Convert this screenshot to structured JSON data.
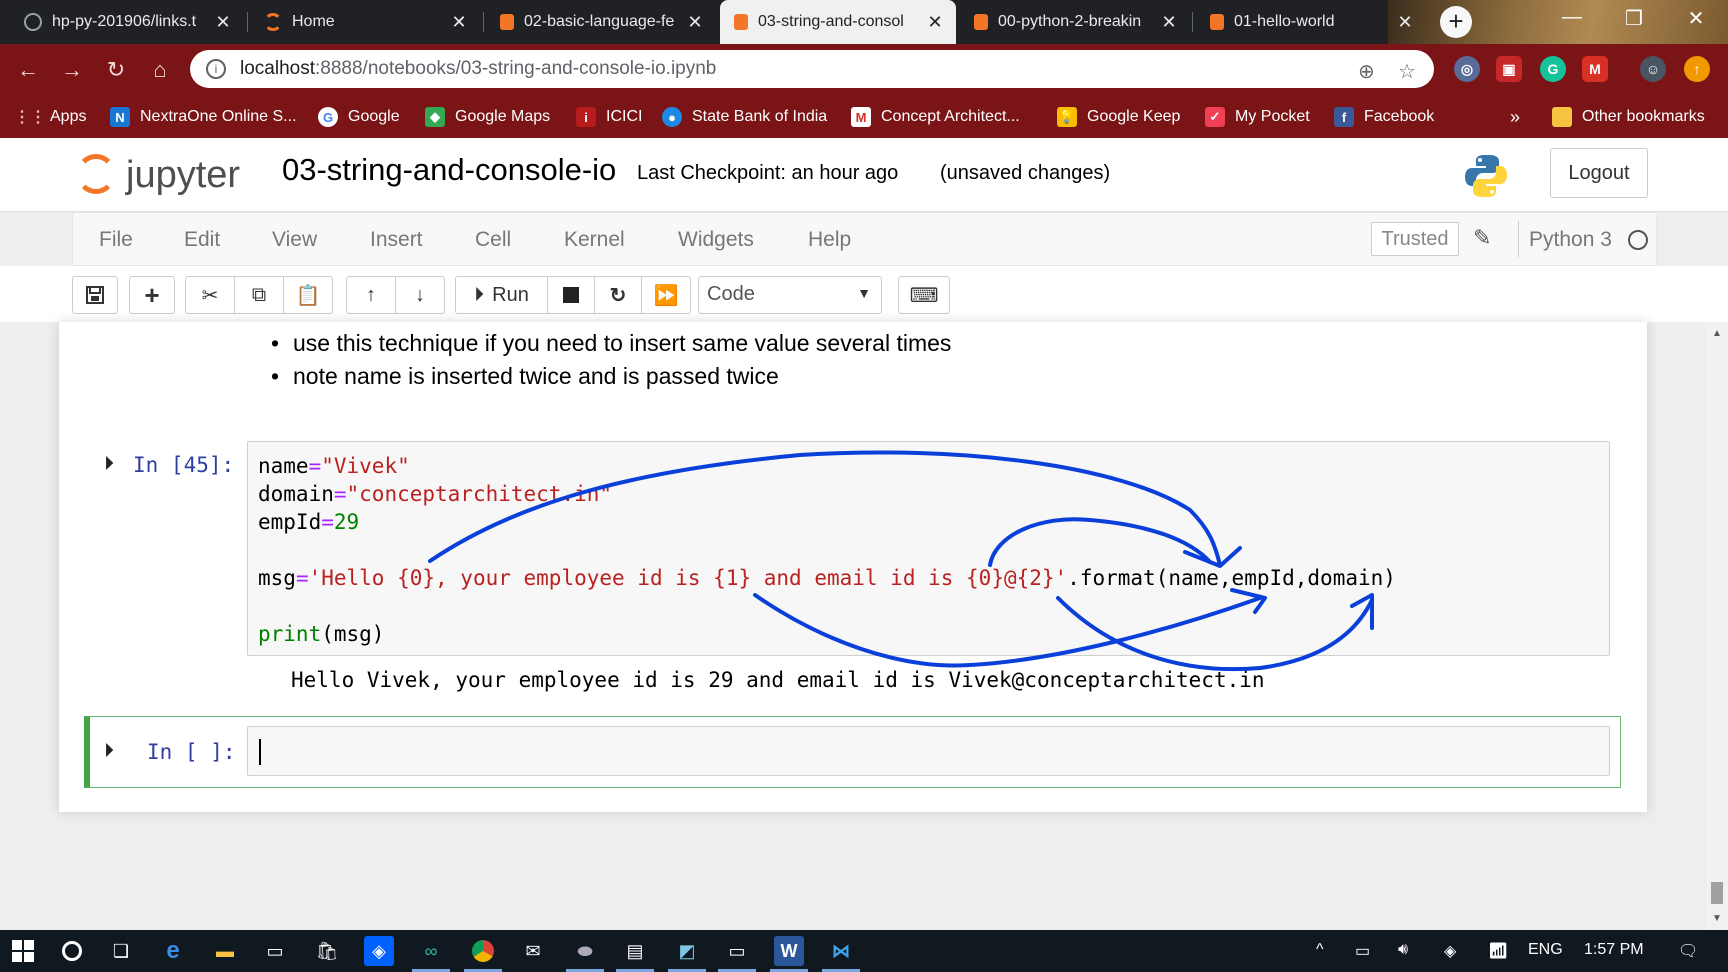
{
  "browser": {
    "tabs": [
      {
        "title": "hp-py-201906/links.t",
        "favicon": "github-icon",
        "active": false
      },
      {
        "title": "Home",
        "favicon": "jupyter-icon",
        "active": false
      },
      {
        "title": "02-basic-language-fe",
        "favicon": "notebook-icon",
        "active": false
      },
      {
        "title": "03-string-and-consol",
        "favicon": "notebook-icon",
        "active": true
      },
      {
        "title": "00-python-2-breakin",
        "favicon": "notebook-icon",
        "active": false
      },
      {
        "title": "01-hello-world",
        "favicon": "notebook-icon",
        "active": false
      }
    ],
    "address": {
      "host": "localhost",
      "path": ":8888/notebooks/03-string-and-console-io.ipynb"
    },
    "bookmarks": [
      {
        "label": "Apps",
        "icon": "apps-grid-icon"
      },
      {
        "label": "NextraOne Online S...",
        "icon": "nextraone-icon"
      },
      {
        "label": "Google",
        "icon": "google-icon"
      },
      {
        "label": "Google Maps",
        "icon": "maps-icon"
      },
      {
        "label": "ICICI",
        "icon": "icici-icon"
      },
      {
        "label": "State Bank of India",
        "icon": "sbi-icon"
      },
      {
        "label": "Concept Architect...",
        "icon": "gmail-icon"
      },
      {
        "label": "Google Keep",
        "icon": "keep-icon"
      },
      {
        "label": "My Pocket",
        "icon": "pocket-icon"
      },
      {
        "label": "Facebook",
        "icon": "facebook-icon"
      }
    ],
    "bookmarks_more": "»",
    "other_bookmarks": "Other bookmarks"
  },
  "jupyter": {
    "logo_text": "jupyter",
    "notebook_name": "03-string-and-console-io",
    "checkpoint": "Last Checkpoint: an hour ago",
    "unsaved": "(unsaved changes)",
    "logout": "Logout",
    "menu": [
      "File",
      "Edit",
      "View",
      "Insert",
      "Cell",
      "Kernel",
      "Widgets",
      "Help"
    ],
    "trusted": "Trusted",
    "kernel": "Python 3",
    "run_label": "Run",
    "cell_type": "Code"
  },
  "notebook": {
    "bullets": [
      "use this technique if you need to insert same value several times",
      "note name is inserted twice and is passed twice"
    ],
    "cell_45": {
      "prompt": "In [45]:",
      "lines": {
        "l1a": "name",
        "l1b": "=",
        "l1c": "\"Vivek\"",
        "l2a": "domain",
        "l2b": "=",
        "l2c": "\"conceptarchitect.in\"",
        "l3a": "empId",
        "l3b": "=",
        "l3c": "29",
        "l4a": "msg",
        "l4b": "=",
        "l4c": "'Hello {0}, your employee id is {1} and email id is {0}@{2}'",
        "l4d": ".format(name,empId,domain)",
        "l5a": "print",
        "l5b": "(msg)"
      }
    },
    "output_45": "Hello Vivek, your employee id is 29 and email id is Vivek@conceptarchitect.in",
    "cell_new": {
      "prompt": "In [ ]:"
    }
  },
  "taskbar": {
    "language": "ENG",
    "time": "1:57 PM"
  },
  "colors": {
    "chrome_frame": "#7a1416",
    "jupyter_orange": "#f37626",
    "prompt_blue": "#303f9f",
    "string_red": "#ba2121",
    "number_green": "#008000",
    "annotation_blue": "#0b3fd9",
    "edit_cell_green": "#42a545"
  }
}
